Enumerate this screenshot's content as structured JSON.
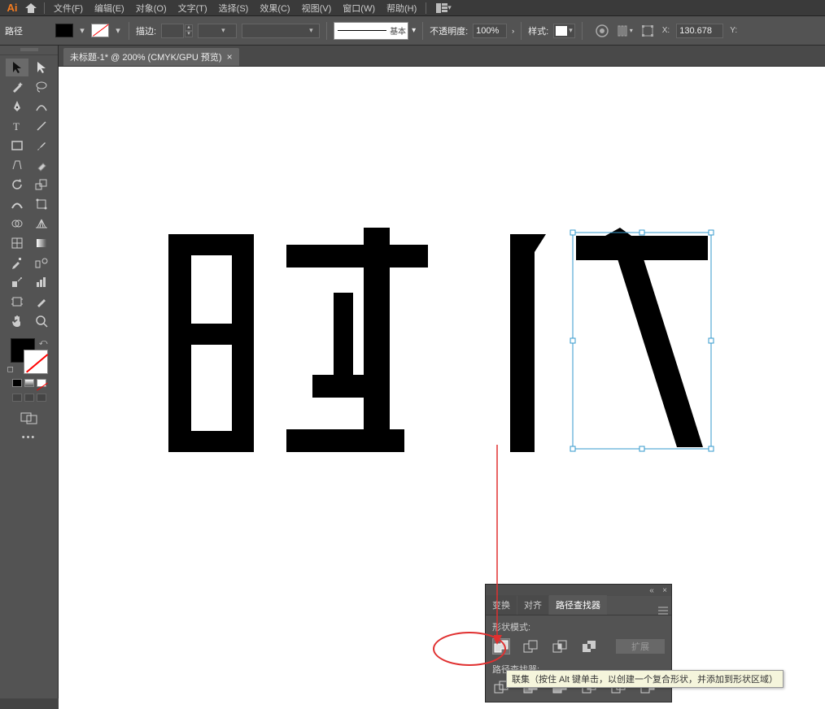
{
  "app": {
    "logo_text": "Ai"
  },
  "menu": {
    "file": "文件(F)",
    "edit": "编辑(E)",
    "object": "对象(O)",
    "type": "文字(T)",
    "select": "选择(S)",
    "effect": "效果(C)",
    "view": "视图(V)",
    "window": "窗口(W)",
    "help": "帮助(H)"
  },
  "control": {
    "selection_label": "路径",
    "stroke_label": "描边:",
    "stroke_weight": "",
    "brush_label": "基本",
    "opacity_label": "不透明度:",
    "opacity_value": "100%",
    "style_label": "样式:",
    "x_label": "X:",
    "x_value": "130.678",
    "y_label": "Y:"
  },
  "document": {
    "tab_title": "未标题-1* @ 200% (CMYK/GPU 预览)"
  },
  "pathfinder": {
    "tab_transform": "变换",
    "tab_align": "对齐",
    "tab_pathfinder": "路径查找器",
    "shape_modes_label": "形状模式:",
    "expand_label": "扩展",
    "pathfinders_label": "路径查找器:"
  },
  "tooltip": {
    "text": "联集（按住 Alt 键单击，以创建一个复合形状，并添加到形状区域）"
  },
  "colors": {
    "accent": "#39c"
  }
}
